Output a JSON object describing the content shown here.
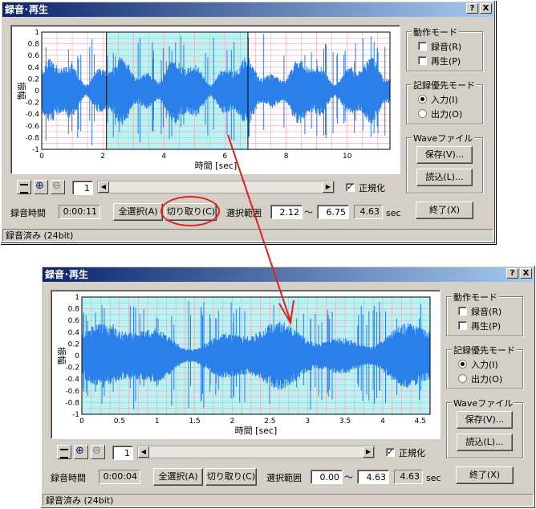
{
  "windows": [
    {
      "title": "録音･再生",
      "help_btn": "?",
      "close_btn": "X",
      "ylabel": "振幅",
      "xlabel": "時間 [sec]",
      "yticks": [
        "1",
        "0.8",
        "0.6",
        "0.4",
        "0.2",
        "0",
        "-0.2",
        "-0.4",
        "-0.6",
        "-0.8",
        "-1"
      ],
      "xticks": [
        "0",
        "2",
        "4",
        "6",
        "8",
        "10"
      ],
      "page_num": "1",
      "normalize_label": "正規化",
      "rec_time_label": "録音時間",
      "rec_time_value": "0:00:11",
      "select_all": "全選択(A)",
      "cut": "切り取り(C)",
      "range_label": "選択範囲",
      "range_start": "2.12",
      "tilde": "～",
      "range_end": "6.75",
      "range_len": "4.63",
      "sec": "sec",
      "mode_group": "動作モード",
      "record": "録音(R)",
      "play": "再生(P)",
      "priority_group": "記録優先モード",
      "input": "入力(I)",
      "output": "出力(O)",
      "wave_group": "Waveファイル",
      "save": "保存(V)...",
      "load": "読込(L)...",
      "exit": "終了(X)",
      "status": "録音済み (24bit)"
    },
    {
      "title": "録音･再生",
      "help_btn": "?",
      "close_btn": "X",
      "ylabel": "振幅",
      "xlabel": "時間 [sec]",
      "yticks": [
        "1",
        "0.8",
        "0.6",
        "0.4",
        "0.2",
        "0",
        "-0.2",
        "-0.4",
        "-0.6",
        "-0.8",
        "-1"
      ],
      "xticks": [
        "0",
        "0.5",
        "1",
        "1.5",
        "2",
        "2.5",
        "3",
        "3.5",
        "4",
        "4.5"
      ],
      "page_num": "1",
      "normalize_label": "正規化",
      "rec_time_label": "録音時間",
      "rec_time_value": "0:00:04",
      "select_all": "全選択(A)",
      "cut": "切り取り(C)",
      "range_label": "選択範囲",
      "range_start": "0.00",
      "tilde": "～",
      "range_end": "4.63",
      "range_len": "4.63",
      "sec": "sec",
      "mode_group": "動作モード",
      "record": "録音(R)",
      "play": "再生(P)",
      "priority_group": "記録優先モード",
      "input": "入力(I)",
      "output": "出力(O)",
      "wave_group": "Waveファイル",
      "save": "保存(V)...",
      "load": "読込(L)...",
      "exit": "終了(X)",
      "status": "録音済み (24bit)"
    }
  ],
  "chart_data": [
    {
      "type": "line",
      "xlim": [
        0,
        11.4
      ],
      "ylim": [
        -1,
        1
      ],
      "selection": [
        2.12,
        6.75
      ],
      "series_color": "#2a7fe8",
      "grid_color": "#f2a0b0"
    },
    {
      "type": "line",
      "xlim": [
        0,
        4.63
      ],
      "ylim": [
        -1,
        1
      ],
      "series_color": "#2a7fe8",
      "grid_color": "#f2a0b0"
    }
  ],
  "colors": {
    "selection": "#b8f4f4",
    "wave": "#2a7fe8",
    "annotation": "#e02020"
  }
}
